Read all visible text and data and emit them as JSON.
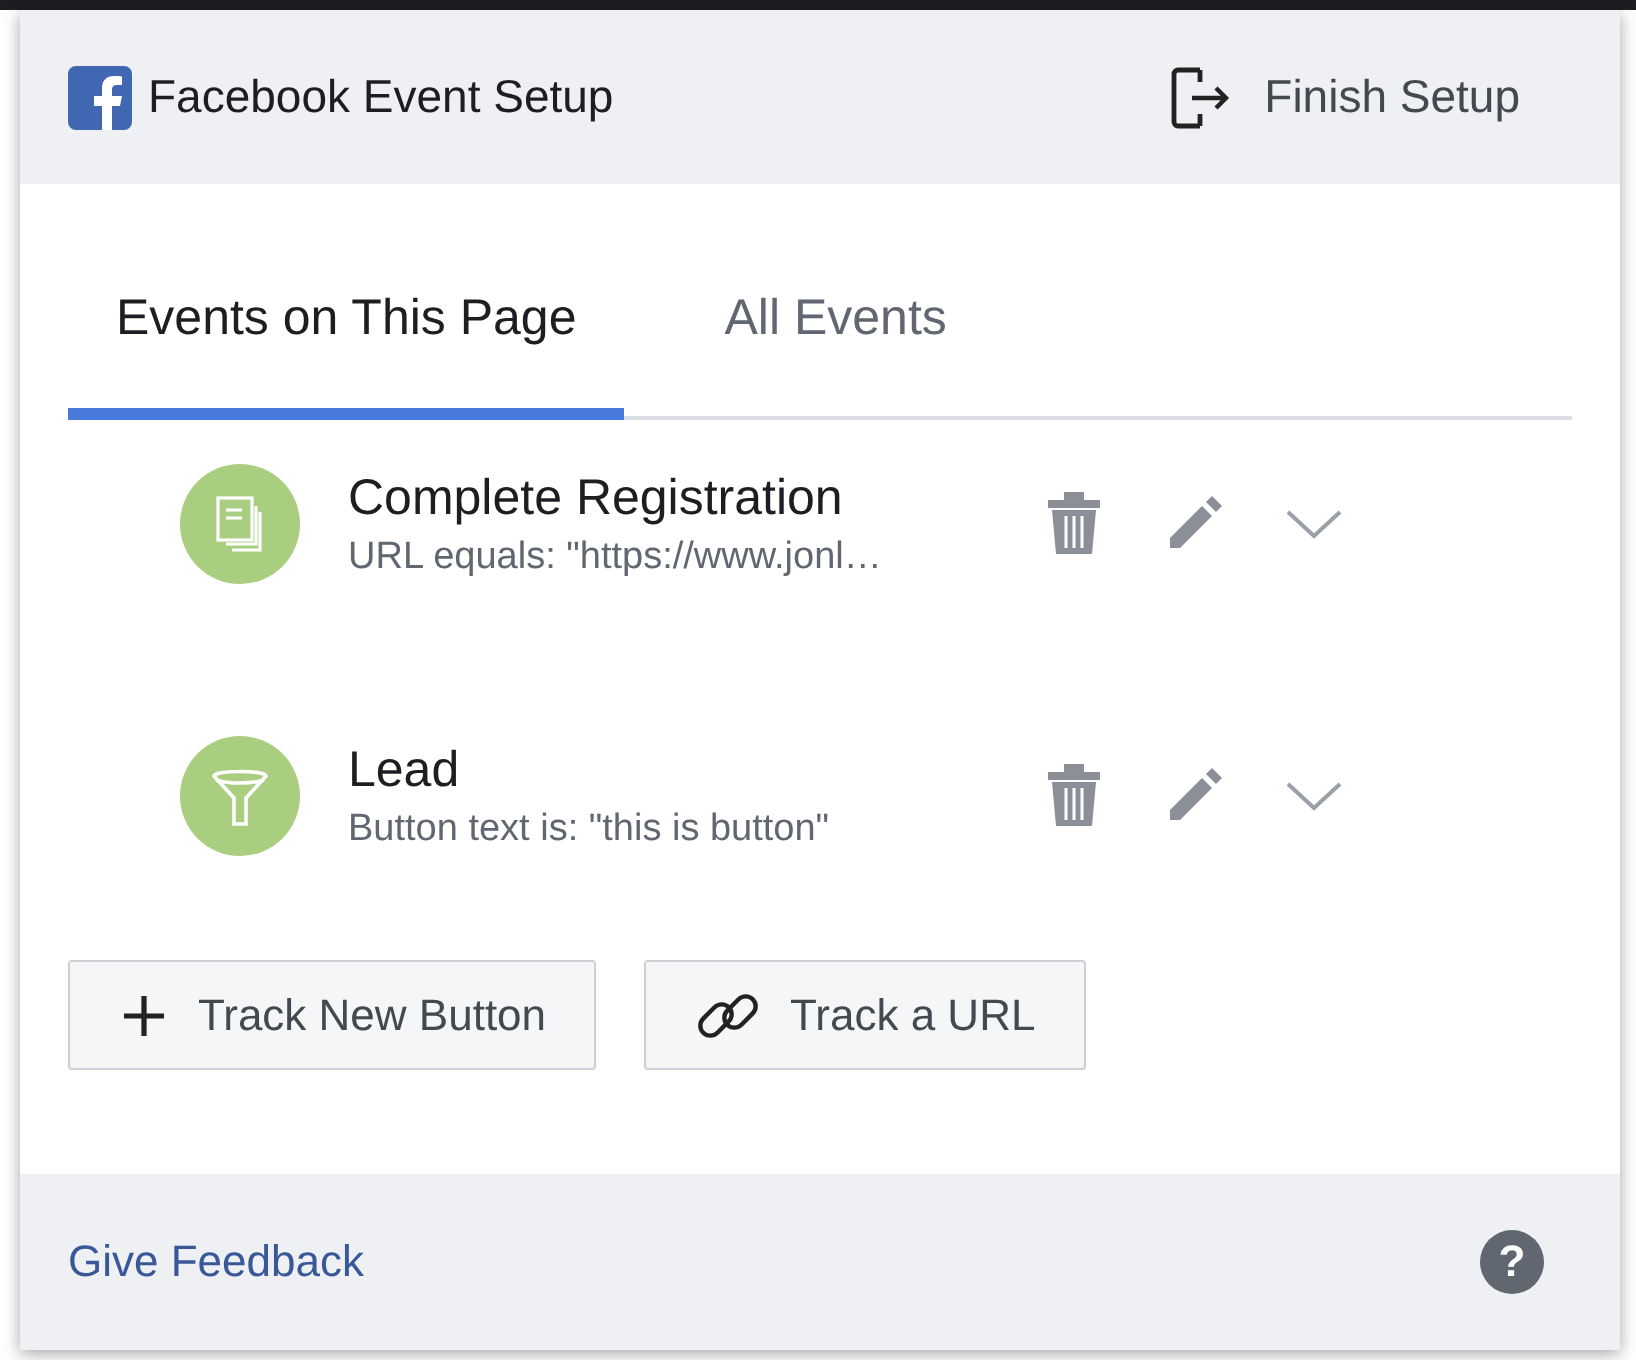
{
  "header": {
    "title": "Facebook Event Setup",
    "finish_button": "Finish Setup"
  },
  "tabs": [
    {
      "label": "Events on This Page",
      "selected": true
    },
    {
      "label": "All Events",
      "selected": false
    }
  ],
  "events": [
    {
      "name": "Complete Registration",
      "detail": "URL equals: \"https://www.jonl…",
      "kind": "document"
    },
    {
      "name": "Lead",
      "detail": "Button text is: \"this is button\"",
      "kind": "funnel"
    }
  ],
  "actions": [
    {
      "label": "Track New Button",
      "kind": "plus"
    },
    {
      "label": "Track a URL",
      "kind": "link"
    }
  ],
  "footer": {
    "link": "Give Feedback",
    "help": "?"
  }
}
